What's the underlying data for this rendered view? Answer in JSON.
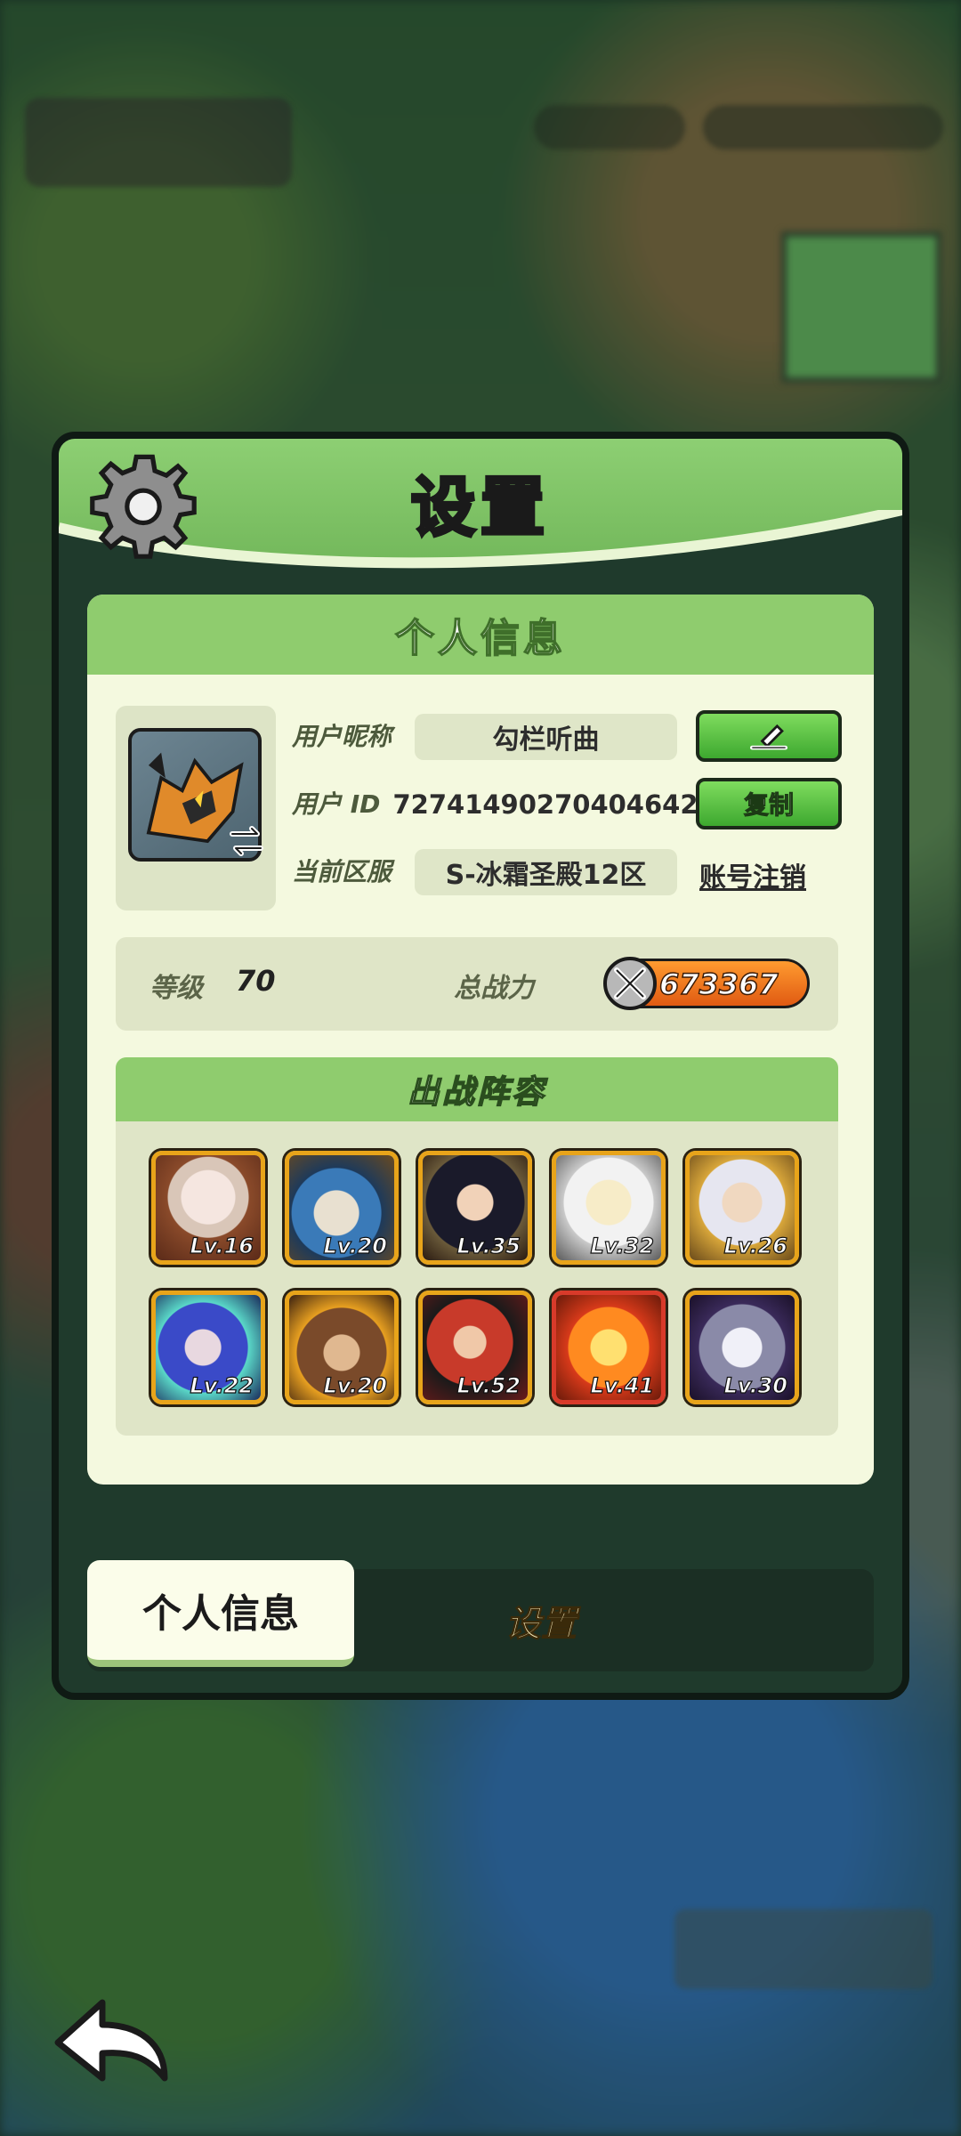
{
  "dialog": {
    "title": "设置"
  },
  "info_card": {
    "title": "个人信息",
    "nickname_label": "用户昵称",
    "nickname_value": "勾栏听曲",
    "user_id_label": "用户 ID",
    "user_id_value": "72741490270404642",
    "server_label": "当前区服",
    "server_value": "S-冰霜圣殿12区",
    "edit_icon": "pencil-icon",
    "copy_label": "复制",
    "deregister_label": "账号注销"
  },
  "stats": {
    "level_label": "等级",
    "level_value": "70",
    "power_label": "总战力",
    "power_value": "673367"
  },
  "lineup": {
    "title": "出战阵容",
    "heroes": [
      {
        "level": "Lv.16",
        "rarity": "gold"
      },
      {
        "level": "Lv.20",
        "rarity": "gold"
      },
      {
        "level": "Lv.35",
        "rarity": "gold"
      },
      {
        "level": "Lv.32",
        "rarity": "gold"
      },
      {
        "level": "Lv.26",
        "rarity": "gold"
      },
      {
        "level": "Lv.22",
        "rarity": "gold"
      },
      {
        "level": "Lv.20",
        "rarity": "gold"
      },
      {
        "level": "Lv.52",
        "rarity": "gold"
      },
      {
        "level": "Lv.41",
        "rarity": "red"
      },
      {
        "level": "Lv.30",
        "rarity": "gold"
      }
    ]
  },
  "tabs": {
    "active": "个人信息",
    "inactive": "设置"
  },
  "colors": {
    "header_green": "#8dcf73",
    "card_bg": "#f4f9df",
    "button_green": "#3da82f",
    "power_orange": "#e05a12",
    "dialog_bg": "#1f3a2c"
  }
}
